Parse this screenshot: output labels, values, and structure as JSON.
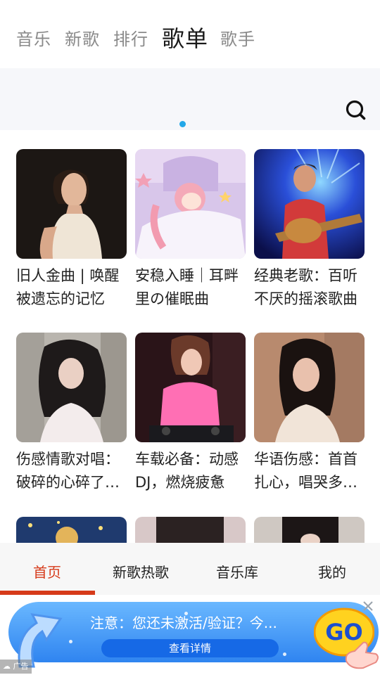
{
  "top_tabs": {
    "items": [
      {
        "label": "音乐"
      },
      {
        "label": "新歌"
      },
      {
        "label": "排行"
      },
      {
        "label": "歌单"
      },
      {
        "label": "歌手"
      }
    ],
    "active_index": 3,
    "accent_color": "#22a7e8"
  },
  "search": {
    "icon": "search-icon"
  },
  "playlists": [
    {
      "title": "旧人金曲 | 唤醒被遗忘的记忆"
    },
    {
      "title": "安稳入睡｜耳畔里の催眠曲"
    },
    {
      "title": "经典老歌：百听不厌的摇滚歌曲"
    },
    {
      "title": "伤感情歌对唱：破碎的心碎了一地"
    },
    {
      "title": "车载必备：动感DJ，燃烧疲惫"
    },
    {
      "title": "华语伤感：首首扎心，唱哭多少人"
    }
  ],
  "bottom_nav": {
    "items": [
      {
        "label": "首页"
      },
      {
        "label": "新歌热歌"
      },
      {
        "label": "音乐库"
      },
      {
        "label": "我的"
      }
    ],
    "active_index": 0,
    "active_color": "#d63a1a"
  },
  "ad": {
    "text": "注意：您还未激活/验证？今...",
    "button_label": "查看详情",
    "go_label": "GO",
    "badge": "广告"
  }
}
